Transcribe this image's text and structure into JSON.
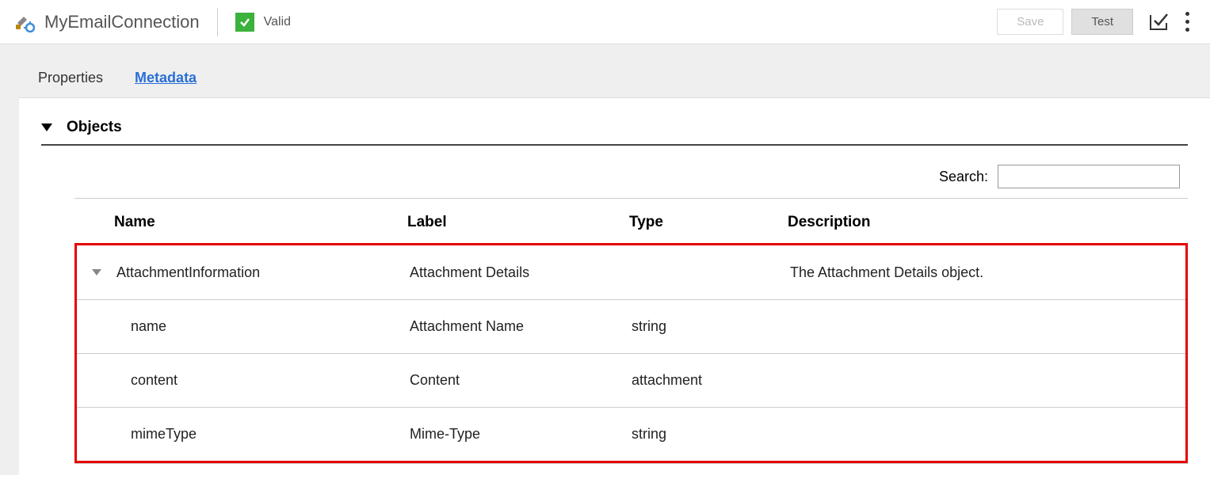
{
  "header": {
    "title": "MyEmailConnection",
    "status": "Valid",
    "save_label": "Save",
    "test_label": "Test"
  },
  "tabs": {
    "items": [
      {
        "label": "Properties",
        "active": false
      },
      {
        "label": "Metadata",
        "active": true
      }
    ]
  },
  "section": {
    "title": "Objects"
  },
  "search": {
    "label": "Search:",
    "value": ""
  },
  "table": {
    "columns": {
      "name": "Name",
      "label": "Label",
      "type": "Type",
      "description": "Description"
    },
    "rows": [
      {
        "expandable": true,
        "name": "AttachmentInformation",
        "label": "Attachment Details",
        "type": "",
        "description": "The Attachment Details object.",
        "children": [
          {
            "name": "name",
            "label": "Attachment Name",
            "type": "string",
            "description": ""
          },
          {
            "name": "content",
            "label": "Content",
            "type": "attachment",
            "description": ""
          },
          {
            "name": "mimeType",
            "label": "Mime-Type",
            "type": "string",
            "description": ""
          }
        ]
      }
    ]
  }
}
